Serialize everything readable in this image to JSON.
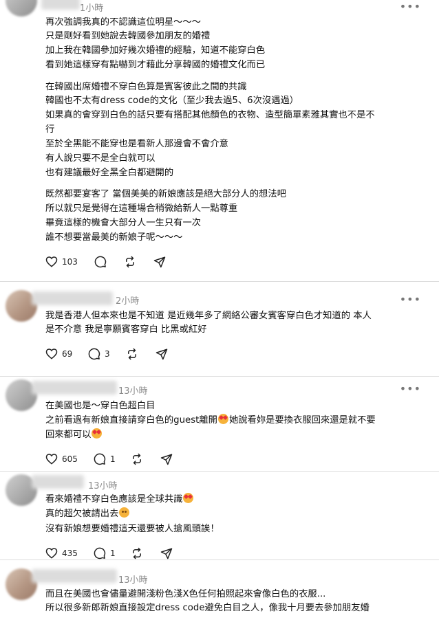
{
  "posts": [
    {
      "time": "1小時",
      "lines": [
        "再次強調我真的不認識這位明星～～～",
        "只是剛好看到她說去韓國參加朋友的婚禮",
        "加上我在韓國參加好幾次婚禮的經驗，知道不能穿白色",
        "看到她這樣穿有點嚇到才藉此分享韓國的婚禮文化而已",
        "在韓國出席婚禮不穿白色算是賓客彼此之間的共識",
        "韓國也不太有dress code的文化（至少我去過5、6次沒遇過）",
        "如果真的會穿到白色的話只要有搭配其他顏色的衣物、造型簡單素雅其實也不是不",
        "行",
        "至於全黑能不能穿也是看新人那邊會不會介意",
        "有人說只要不是全白就可以",
        "也有建議最好全黑全白都避開的",
        "既然都要宴客了 當個美美的新娘應該是絕大部分人的想法吧",
        "所以就只是覺得在這種場合稍微給新人一點尊重",
        "畢竟這樣的機會大部分人一生只有一次",
        "誰不想要當最美的新娘子呢～～～"
      ],
      "likes": "103",
      "comments": ""
    },
    {
      "time": "2小時",
      "lines": [
        "我是香港人但本來也是不知道 是近幾年多了網絡公審女賓客穿白色才知道的 本人",
        "是不介意 我是寧願賓客穿白 比黑或紅好"
      ],
      "likes": "69",
      "comments": "3"
    },
    {
      "time": "13小時",
      "lines": [
        "在美國也是～穿白色超白目",
        "之前看過有新娘直接請穿白色的guest離開",
        "她說看妳是要換衣服回來還是就不要",
        "回來都可以"
      ],
      "likes": "605",
      "comments": "1"
    },
    {
      "time": "13小時",
      "lines": [
        "看來婚禮不穿白色應該是全球共識",
        "真的超欠被請出去",
        "沒有新娘想要婚禮這天還要被人搶風頭誒！"
      ],
      "likes": "435",
      "comments": "1"
    },
    {
      "time": "13小時",
      "lines": [
        "而且在美國也會儘量避開淺粉色淺X色任何拍照起來會像白色的衣服...",
        "所以很多新郎新娘直接設定dress code避免白目之人，像我十月要去參加朋友婚"
      ]
    }
  ]
}
